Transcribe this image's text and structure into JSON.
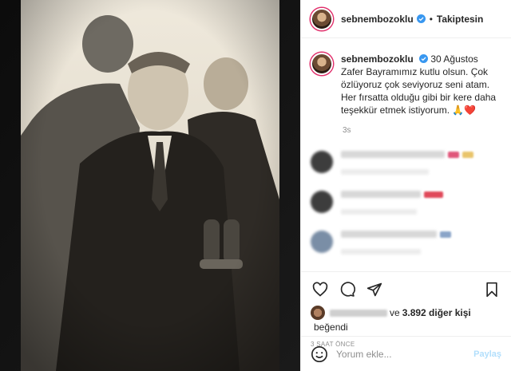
{
  "header": {
    "username": "sebnembozoklu",
    "separator": "•",
    "follow_label": "Takiptesin"
  },
  "caption": {
    "username": "sebnembozoklu",
    "text": "30 Ağustos Zafer Bayramımız kutlu olsun. Çok özlüyoruz çok seviyoruz seni atam. Her fırsatta olduğu gibi bir kere daha teşekkür etmek istiyorum. 🙏❤️",
    "time": "3s"
  },
  "comments_mark_colors": [
    "#e0567a",
    "#e0495a",
    "#8aa4c8"
  ],
  "likes": {
    "connector": "ve",
    "count_text": "3.892 diğer kişi",
    "liked_text": "beğendi"
  },
  "time_ago": "3 SAAT ÖNCE",
  "comment_input": {
    "placeholder": "Yorum ekle...",
    "post_label": "Paylaş"
  },
  "icons": {
    "like": "heart-icon",
    "comment": "comment-bubble-icon",
    "share": "paper-plane-icon",
    "save": "bookmark-icon",
    "emoji": "smiley-icon",
    "verified": "verified-badge-icon"
  },
  "colors": {
    "accent": "#0095f6",
    "verified": "#3897f0",
    "muted": "#8e8e8e",
    "post_disabled": "#b2dffc"
  }
}
